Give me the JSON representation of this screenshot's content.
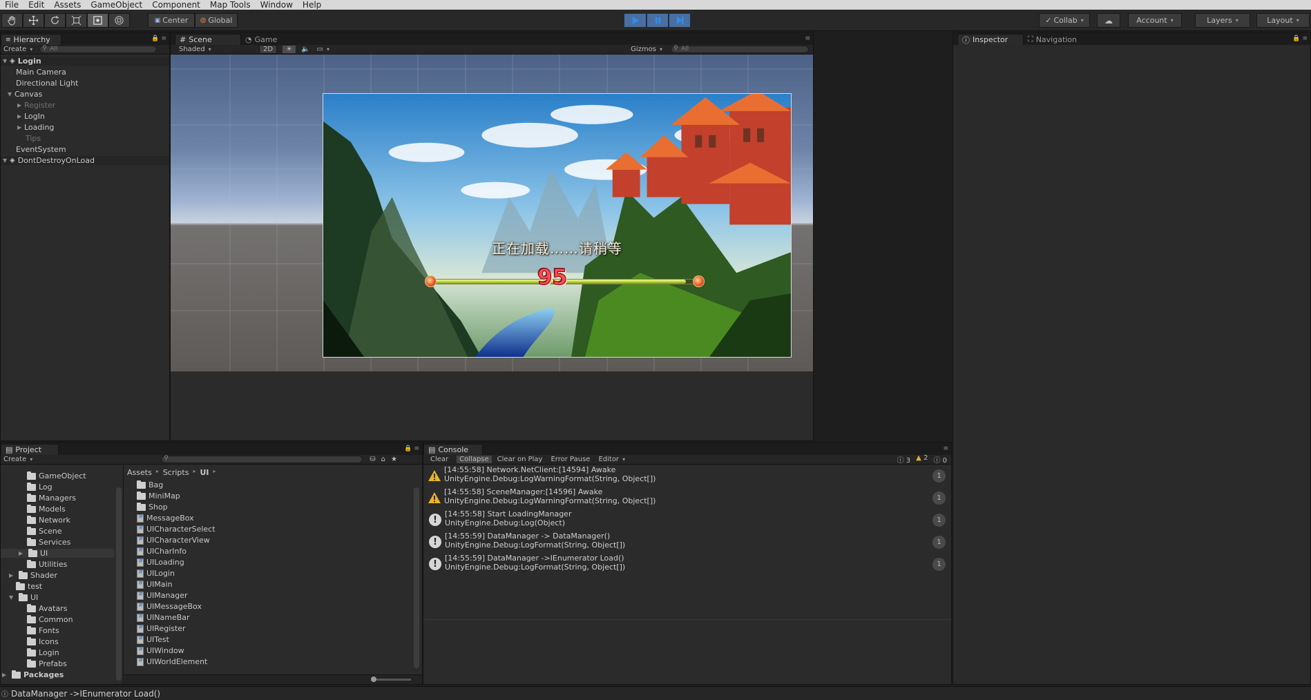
{
  "menu": [
    "File",
    "Edit",
    "Assets",
    "GameObject",
    "Component",
    "Map Tools",
    "Window",
    "Help"
  ],
  "toolbar": {
    "pivot": "Center",
    "space": "Global",
    "collab": "Collab",
    "account": "Account",
    "layers": "Layers",
    "layout": "Layout"
  },
  "hierarchy": {
    "tab": "Hierarchy",
    "create": "Create",
    "search_placeholder": "All",
    "items": [
      {
        "label": "Login",
        "kind": "scene"
      },
      {
        "label": "Main Camera"
      },
      {
        "label": "Directional Light"
      },
      {
        "label": "Canvas"
      },
      {
        "label": "Register",
        "dim": true
      },
      {
        "label": "LogIn"
      },
      {
        "label": "Loading"
      },
      {
        "label": "Tips",
        "dim": true
      },
      {
        "label": "EventSystem"
      },
      {
        "label": "DontDestroyOnLoad",
        "kind": "scene"
      }
    ]
  },
  "scene": {
    "tab_scene": "Scene",
    "tab_game": "Game",
    "shading": "Shaded",
    "mode_2d": "2D",
    "gizmos": "Gizmos",
    "search_placeholder": "All",
    "loading_text": "正在加载……请稍等",
    "progress_value": 95,
    "progress_fraction": 0.95
  },
  "inspector": {
    "tab_inspector": "Inspector",
    "tab_navigation": "Navigation"
  },
  "project": {
    "tab": "Project",
    "create": "Create",
    "breadcrumb": [
      "Assets",
      "Scripts",
      "UI"
    ],
    "folders": [
      "GameObject",
      "Log",
      "Managers",
      "Models",
      "Network",
      "Scene",
      "Services",
      "UI",
      "Utilities",
      "Shader",
      "test",
      "UI",
      "Avatars",
      "Common",
      "Fonts",
      "Icons",
      "Login",
      "Prefabs"
    ],
    "packages": "Packages",
    "files": [
      "Bag",
      "MiniMap",
      "Shop",
      "MessageBox",
      "UICharacterSelect",
      "UICharacterView",
      "UICharInfo",
      "UILoading",
      "UILogin",
      "UIMain",
      "UIManager",
      "UIMessageBox",
      "UINameBar",
      "UIRegister",
      "UITest",
      "UIWindow",
      "UIWorldElement"
    ]
  },
  "console": {
    "tab": "Console",
    "buttons": [
      "Clear",
      "Collapse",
      "Clear on Play",
      "Error Pause",
      "Editor"
    ],
    "counts": {
      "info": "3",
      "warn": "2",
      "error": "0"
    },
    "entries": [
      {
        "type": "warning",
        "line1": "[14:55:58] Network.NetClient:[14594] Awake",
        "line2": "UnityEngine.Debug:LogWarningFormat(String, Object[])",
        "count": "1"
      },
      {
        "type": "warning",
        "line1": "[14:55:58] SceneManager:[14596] Awake",
        "line2": "UnityEngine.Debug:LogWarningFormat(String, Object[])",
        "count": "1"
      },
      {
        "type": "info",
        "line1": "[14:55:58] Start LoadingManager",
        "line2": "UnityEngine.Debug:Log(Object)",
        "count": "1"
      },
      {
        "type": "info",
        "line1": "[14:55:59] DataManager -> DataManager()",
        "line2": "UnityEngine.Debug:LogFormat(String, Object[])",
        "count": "1"
      },
      {
        "type": "info",
        "line1": "[14:55:59] DataManager ->IEnumerator Load()",
        "line2": "UnityEngine.Debug:LogFormat(String, Object[])",
        "count": "1"
      }
    ]
  },
  "status": "DataManager ->IEnumerator Load()",
  "colors": {
    "accent": "#4a6e9e",
    "warning": "#e8b32a",
    "progress": "#c3d83a",
    "progress_number": "#ff4a56"
  }
}
